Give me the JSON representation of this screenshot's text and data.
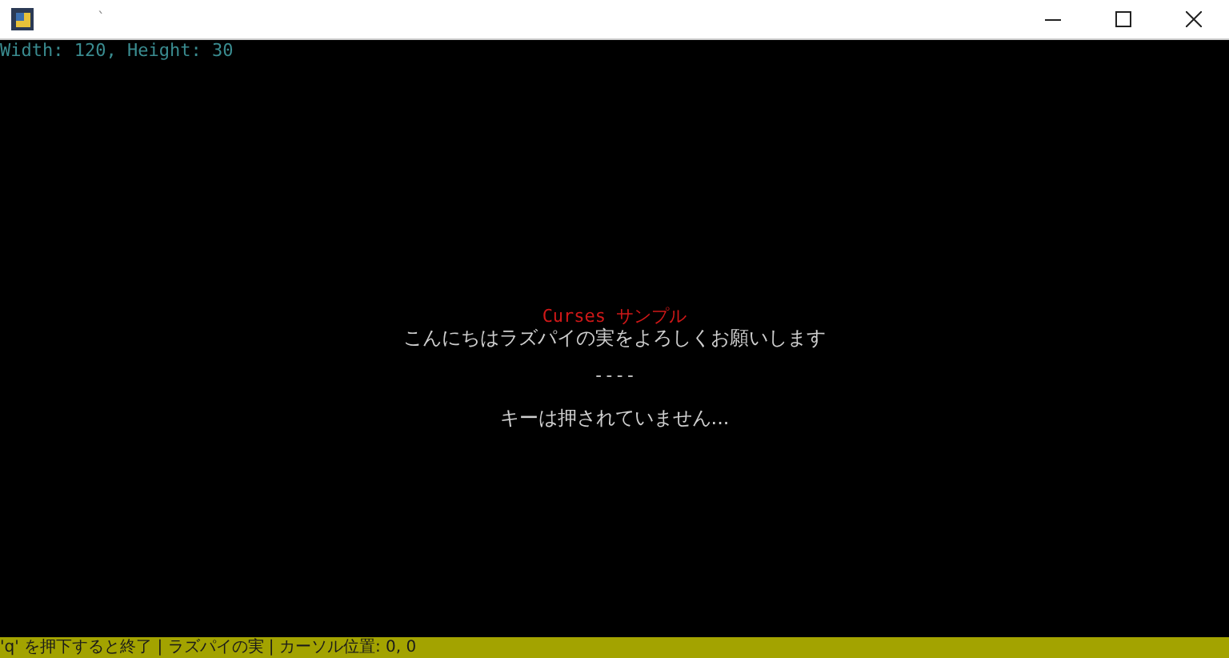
{
  "window": {
    "title": "`"
  },
  "terminal": {
    "size_line": "Width: 120, Height: 30",
    "heading": "Curses サンプル",
    "greeting": "こんにちはラズパイの実をよろしくお願いします",
    "separator": "----",
    "message": "キーは押されていません..."
  },
  "status_bar": "'q' を押下すると終了 | ラズパイの実 | カーソル位置: 0, 0"
}
